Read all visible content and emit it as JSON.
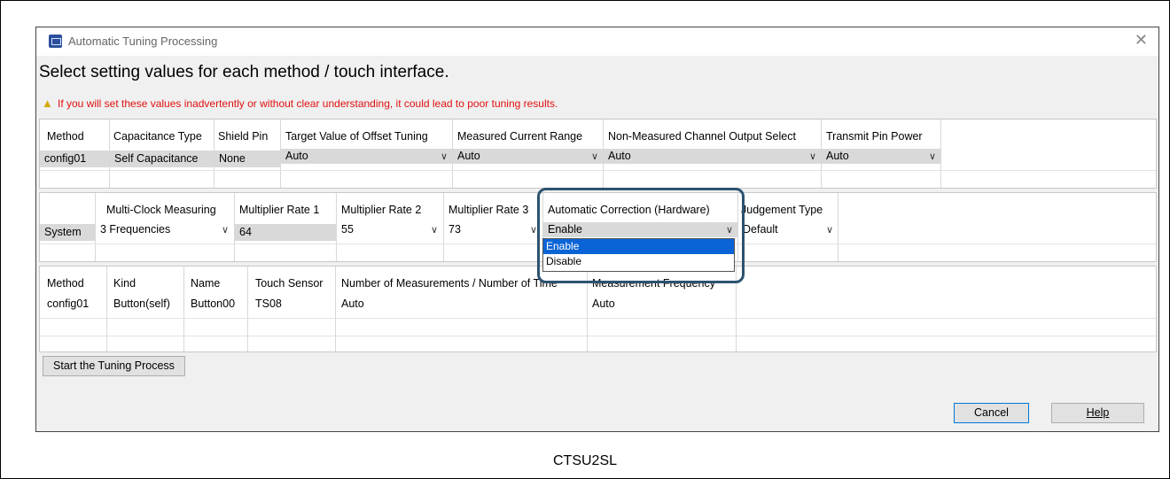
{
  "window": {
    "title": "Automatic Tuning Processing",
    "close_glyph": "✕"
  },
  "heading": "Select setting values for each method / touch interface.",
  "warning": {
    "icon": "warning-triangle-icon",
    "text": "If you will set these values inadvertently or without clear understanding, it could lead to poor tuning results."
  },
  "method_table": {
    "headers": [
      "Method",
      "Capacitance Type",
      "Shield Pin",
      "Target Value of Offset Tuning",
      "Measured Current Range",
      "Non-Measured Channel Output Select",
      "Transmit Pin Power"
    ],
    "row": [
      "config01",
      "Self Capacitance",
      "None",
      "Auto",
      "Auto",
      "Auto",
      "Auto"
    ]
  },
  "system_table": {
    "headers": [
      "",
      "Multi-Clock Measuring",
      "Multiplier Rate 1",
      "Multiplier Rate 2",
      "Multiplier Rate 3",
      "Automatic Correction (Hardware)",
      "Judgement Type"
    ],
    "row": [
      "System",
      "3 Frequencies",
      "64",
      "55",
      "73",
      "Enable",
      "Default"
    ]
  },
  "dropdown": {
    "options": [
      "Enable",
      "Disable"
    ],
    "selected": "Enable"
  },
  "interface_table": {
    "headers": [
      "Method",
      "Kind",
      "Name",
      "Touch Sensor",
      "Number of Measurements / Number of Time",
      "Measurement Frequency"
    ],
    "row": [
      "config01",
      "Button(self)",
      "Button00",
      "TS08",
      "Auto",
      "Auto"
    ]
  },
  "buttons": {
    "start": "Start the Tuning Process",
    "cancel": "Cancel",
    "help": "Help"
  },
  "caption": "CTSU2SL",
  "colors": {
    "warning_text": "#e01010",
    "selection": "#0a64d6",
    "highlight_border": "#2c5370"
  }
}
